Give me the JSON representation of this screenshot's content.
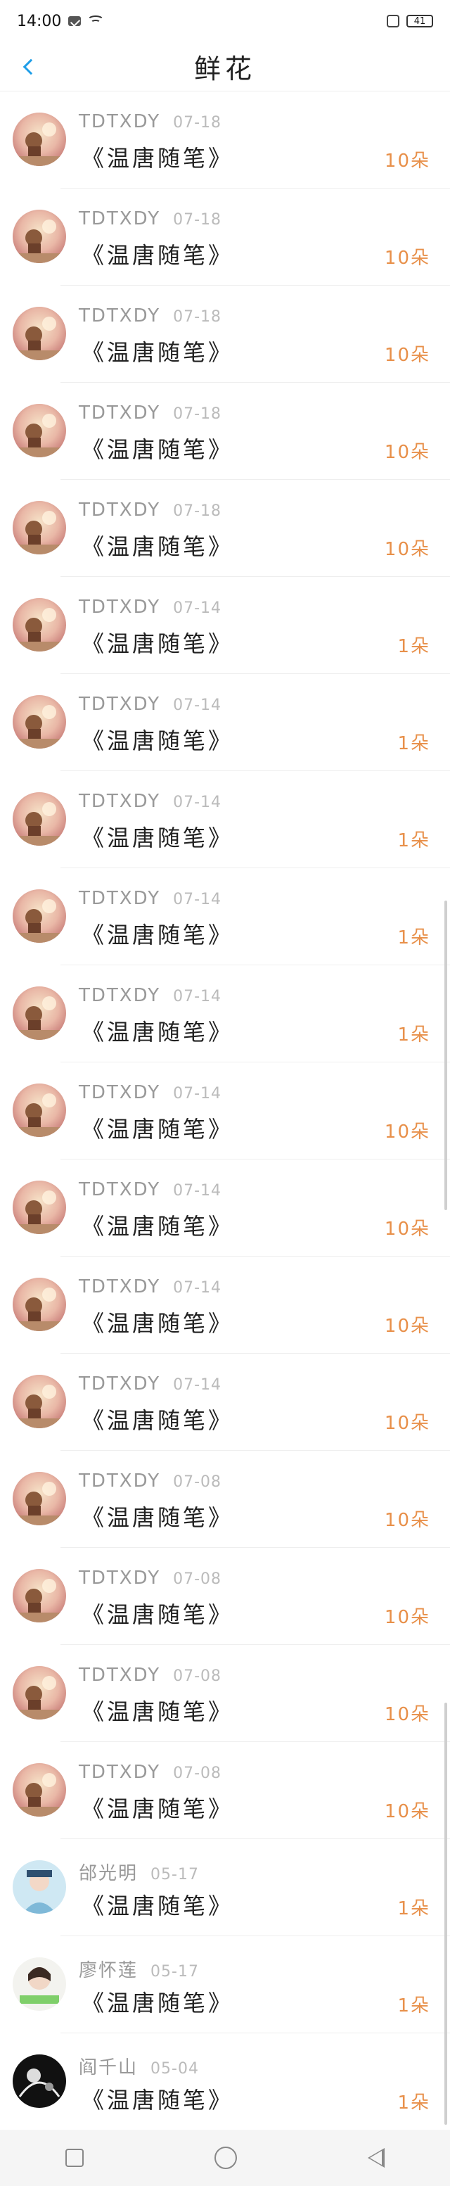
{
  "status": {
    "time": "14:00",
    "battery": "41"
  },
  "header": {
    "title": "鲜花"
  },
  "colors": {
    "accent": "#1f9ee8",
    "count": "#e8904a"
  },
  "rows": [
    {
      "name": "TDTXDY",
      "date": "07-18",
      "book": "《温唐随笔》",
      "count": "10朵",
      "avatar": "warm-1"
    },
    {
      "name": "TDTXDY",
      "date": "07-18",
      "book": "《温唐随笔》",
      "count": "10朵",
      "avatar": "warm-1"
    },
    {
      "name": "TDTXDY",
      "date": "07-18",
      "book": "《温唐随笔》",
      "count": "10朵",
      "avatar": "warm-1"
    },
    {
      "name": "TDTXDY",
      "date": "07-18",
      "book": "《温唐随笔》",
      "count": "10朵",
      "avatar": "warm-1"
    },
    {
      "name": "TDTXDY",
      "date": "07-18",
      "book": "《温唐随笔》",
      "count": "10朵",
      "avatar": "warm-1"
    },
    {
      "name": "TDTXDY",
      "date": "07-14",
      "book": "《温唐随笔》",
      "count": "1朵",
      "avatar": "warm-1"
    },
    {
      "name": "TDTXDY",
      "date": "07-14",
      "book": "《温唐随笔》",
      "count": "1朵",
      "avatar": "warm-1"
    },
    {
      "name": "TDTXDY",
      "date": "07-14",
      "book": "《温唐随笔》",
      "count": "1朵",
      "avatar": "warm-1"
    },
    {
      "name": "TDTXDY",
      "date": "07-14",
      "book": "《温唐随笔》",
      "count": "1朵",
      "avatar": "warm-1"
    },
    {
      "name": "TDTXDY",
      "date": "07-14",
      "book": "《温唐随笔》",
      "count": "1朵",
      "avatar": "warm-1"
    },
    {
      "name": "TDTXDY",
      "date": "07-14",
      "book": "《温唐随笔》",
      "count": "10朵",
      "avatar": "warm-1"
    },
    {
      "name": "TDTXDY",
      "date": "07-14",
      "book": "《温唐随笔》",
      "count": "10朵",
      "avatar": "warm-1"
    },
    {
      "name": "TDTXDY",
      "date": "07-14",
      "book": "《温唐随笔》",
      "count": "10朵",
      "avatar": "warm-1"
    },
    {
      "name": "TDTXDY",
      "date": "07-14",
      "book": "《温唐随笔》",
      "count": "10朵",
      "avatar": "warm-1"
    },
    {
      "name": "TDTXDY",
      "date": "07-08",
      "book": "《温唐随笔》",
      "count": "10朵",
      "avatar": "warm-1"
    },
    {
      "name": "TDTXDY",
      "date": "07-08",
      "book": "《温唐随笔》",
      "count": "10朵",
      "avatar": "warm-1"
    },
    {
      "name": "TDTXDY",
      "date": "07-08",
      "book": "《温唐随笔》",
      "count": "10朵",
      "avatar": "warm-1"
    },
    {
      "name": "TDTXDY",
      "date": "07-08",
      "book": "《温唐随笔》",
      "count": "10朵",
      "avatar": "warm-1"
    },
    {
      "name": "邰光明",
      "date": "05-17",
      "book": "《温唐随笔》",
      "count": "1朵",
      "avatar": "blue"
    },
    {
      "name": "廖怀莲",
      "date": "05-17",
      "book": "《温唐随笔》",
      "count": "1朵",
      "avatar": "green"
    },
    {
      "name": "阎千山",
      "date": "05-04",
      "book": "《温唐随笔》",
      "count": "1朵",
      "avatar": "dark"
    }
  ]
}
